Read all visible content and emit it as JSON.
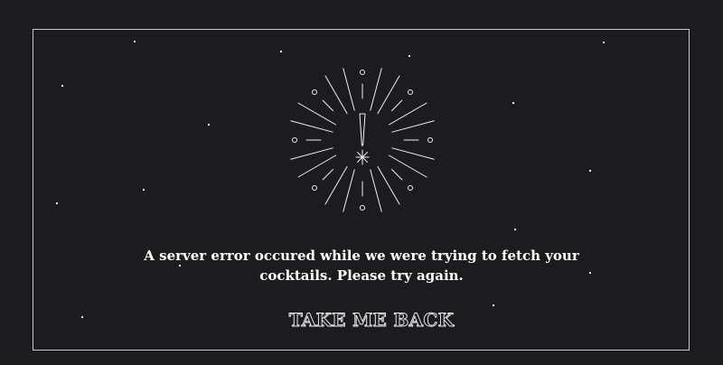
{
  "error": {
    "message": "A server error occured while we were trying to fetch your cocktails. Please try again.",
    "icon": "firework-burst-exclamation-icon"
  },
  "actions": {
    "back_label": "TAKE ME BACK"
  },
  "colors": {
    "background": "#1c1c1e",
    "foreground": "#ffffff",
    "frame": "#c9c9c9"
  }
}
